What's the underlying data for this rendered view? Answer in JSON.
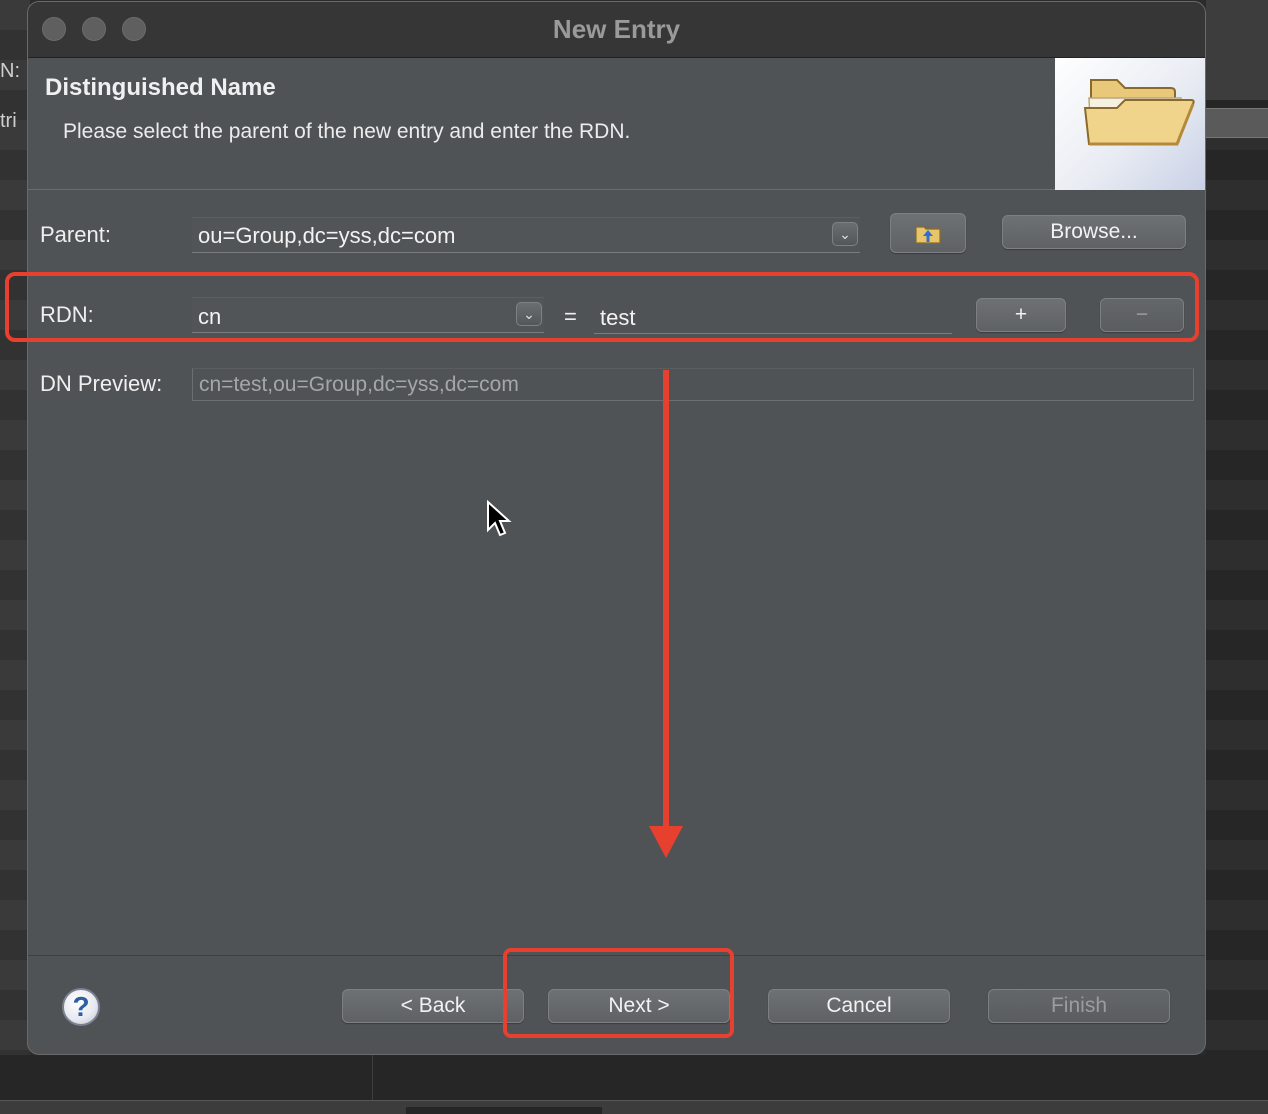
{
  "window": {
    "title": "New Entry"
  },
  "background": {
    "fragments": [
      "N:",
      "tri"
    ]
  },
  "header": {
    "title": "Distinguished Name",
    "description": "Please select the parent of the new entry and enter the RDN."
  },
  "parent": {
    "label": "Parent:",
    "value": "ou=Group,dc=yss,dc=com",
    "browse_label": "Browse..."
  },
  "rdn": {
    "label": "RDN:",
    "attribute": "cn",
    "equals": "=",
    "value": "test",
    "add_label": "+",
    "remove_label": "−"
  },
  "dn_preview": {
    "label": "DN Preview:",
    "value": "cn=test,ou=Group,dc=yss,dc=com"
  },
  "footer": {
    "back_label": "< Back",
    "next_label": "Next >",
    "cancel_label": "Cancel",
    "finish_label": "Finish",
    "help_glyph": "?"
  },
  "icons": {
    "header_image": "open-folder-icon",
    "parent_up": "folder-up-arrow-icon",
    "help": "help-question-icon",
    "cursor": "mouse-pointer-icon"
  },
  "colors": {
    "annotation": "#e8402f",
    "dialog_bg": "#505356",
    "titlebar": "#363636"
  },
  "annotations": [
    "rdn-row-highlight",
    "next-button-highlight",
    "down-arrow"
  ]
}
